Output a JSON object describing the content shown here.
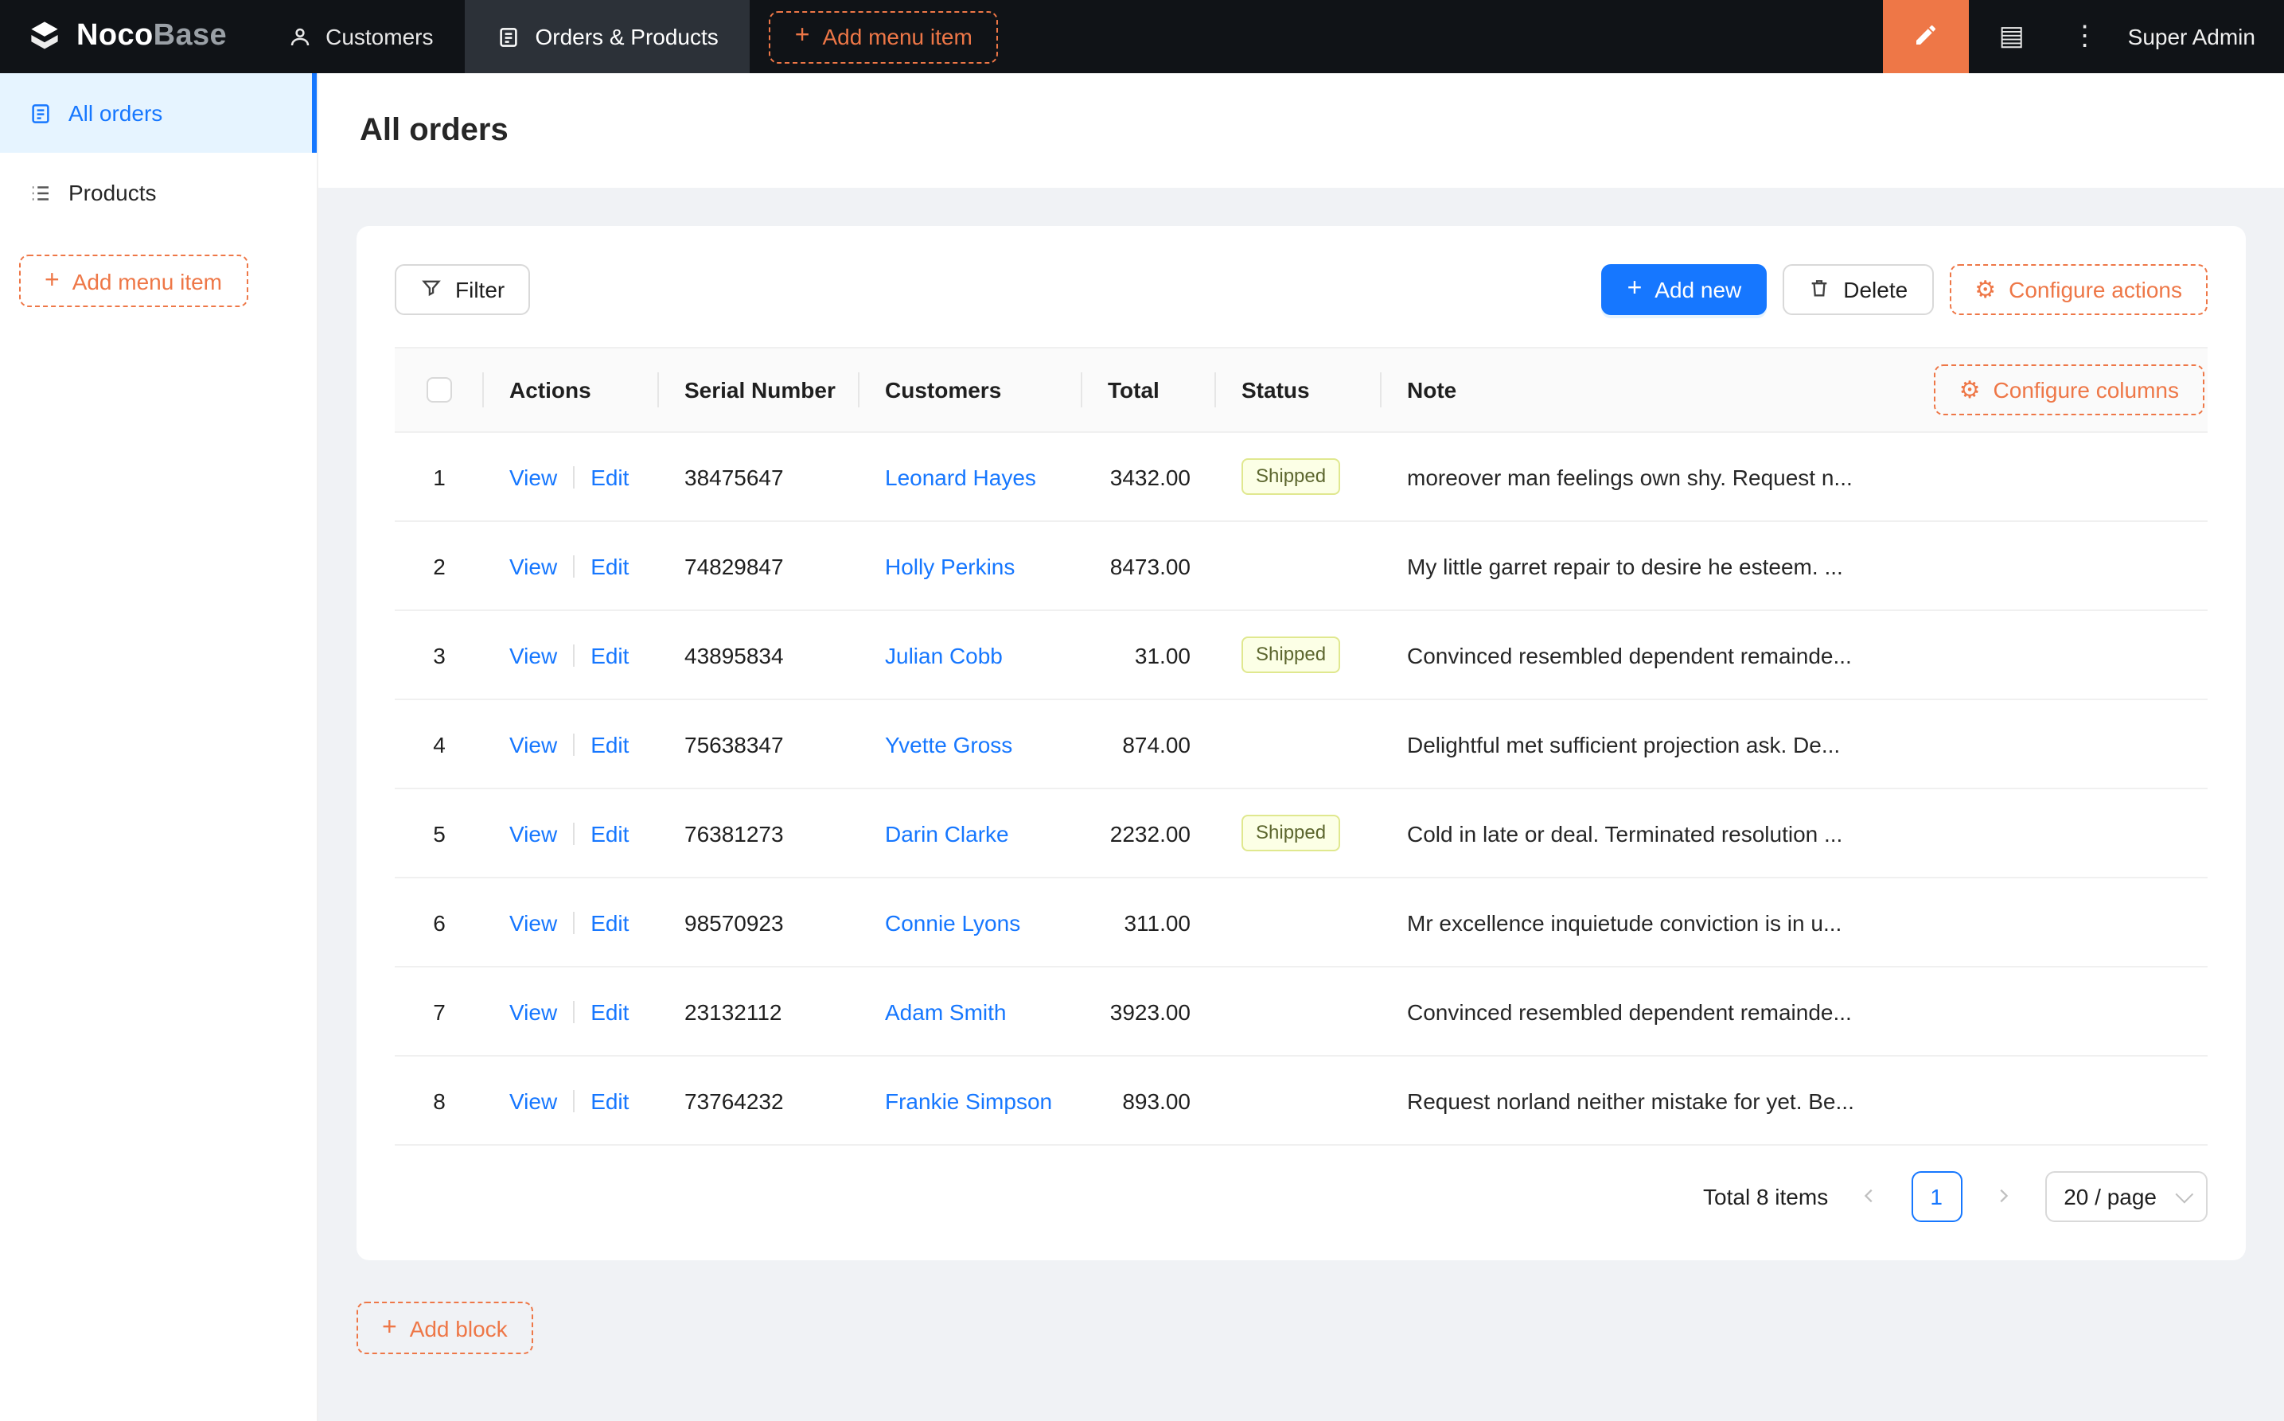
{
  "navbar": {
    "logo": {
      "primary": "Noco",
      "secondary": "Base"
    },
    "items": [
      {
        "label": "Customers"
      },
      {
        "label": "Orders & Products"
      }
    ],
    "add_menu_item_label": "Add menu item",
    "user": "Super Admin"
  },
  "icons": {
    "plus": "+",
    "more": "⋮",
    "collections": "▤",
    "gear": "⚙"
  },
  "sidebar": {
    "items": [
      {
        "label": "All orders"
      },
      {
        "label": "Products"
      }
    ],
    "add_menu_item_label": "Add menu item"
  },
  "page": {
    "title": "All orders"
  },
  "toolbar": {
    "filter_label": "Filter",
    "add_new_label": "Add new",
    "delete_label": "Delete",
    "configure_actions_label": "Configure actions"
  },
  "table": {
    "headers": [
      "Actions",
      "Serial Number",
      "Customers",
      "Total",
      "Status",
      "Note"
    ],
    "configure_columns_label": "Configure columns",
    "actions": {
      "view": "View",
      "edit": "Edit"
    },
    "rows": [
      {
        "index": "1",
        "serial": "38475647",
        "customer": "Leonard Hayes",
        "total": "3432.00",
        "status": "Shipped",
        "note": "moreover man feelings own shy. Request n..."
      },
      {
        "index": "2",
        "serial": "74829847",
        "customer": "Holly Perkins",
        "total": "8473.00",
        "status": "",
        "note": "My little garret repair to desire he esteem. ..."
      },
      {
        "index": "3",
        "serial": "43895834",
        "customer": "Julian Cobb",
        "total": "31.00",
        "status": "Shipped",
        "note": "Convinced resembled dependent remainde..."
      },
      {
        "index": "4",
        "serial": "75638347",
        "customer": "Yvette Gross",
        "total": "874.00",
        "status": "",
        "note": "Delightful met sufficient projection ask. De..."
      },
      {
        "index": "5",
        "serial": "76381273",
        "customer": "Darin Clarke",
        "total": "2232.00",
        "status": "Shipped",
        "note": "Cold in late or deal. Terminated resolution ..."
      },
      {
        "index": "6",
        "serial": "98570923",
        "customer": "Connie Lyons",
        "total": "311.00",
        "status": "",
        "note": "Mr excellence inquietude conviction is in u..."
      },
      {
        "index": "7",
        "serial": "23132112",
        "customer": "Adam Smith",
        "total": "3923.00",
        "status": "",
        "note": "Convinced resembled dependent remainde..."
      },
      {
        "index": "8",
        "serial": "73764232",
        "customer": "Frankie Simpson",
        "total": "893.00",
        "status": "",
        "note": "Request norland neither mistake for yet. Be..."
      }
    ],
    "pagination": {
      "total": "Total 8 items",
      "page": "1",
      "page_size": "20 / page"
    }
  },
  "footer": {
    "add_block_label": "Add block"
  },
  "colors": {
    "accent_orange": "#ee7747",
    "primary_blue": "#1677ff",
    "navbar_bg": "#101317",
    "active_item_bg": "#e6f4ff",
    "tag_bg": "#fcffe6"
  }
}
